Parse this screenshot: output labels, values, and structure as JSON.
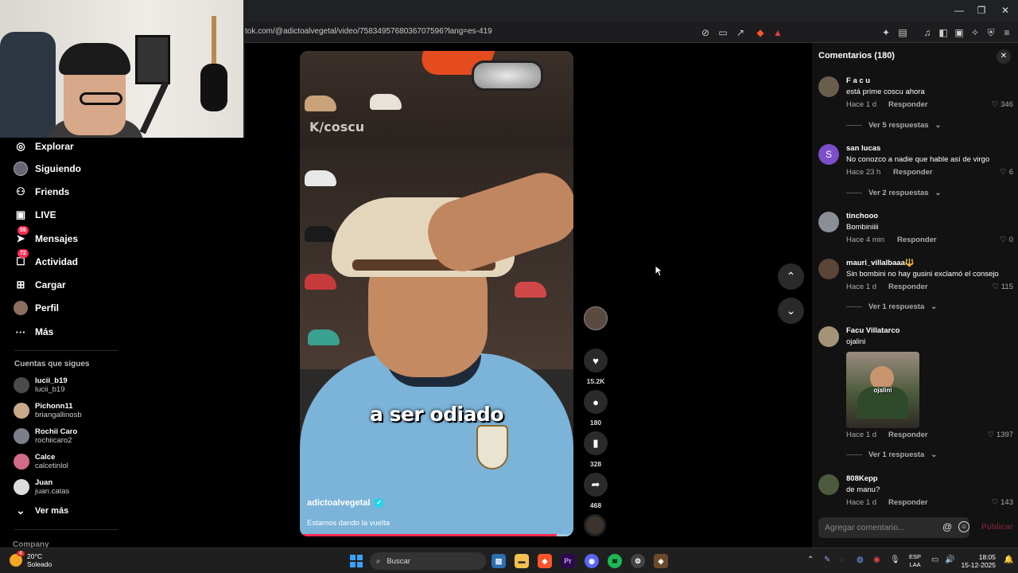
{
  "browser": {
    "url": "tok.com/@adictoalvegetal/video/7583495768036707596?lang=es-419",
    "window_controls": [
      "—",
      "❐",
      "✕"
    ]
  },
  "sidebar": {
    "items": [
      {
        "label": "Explorar",
        "icon": "compass-icon",
        "glyph": "◎",
        "badge": ""
      },
      {
        "label": "Siguiendo",
        "icon": "following-avatar-icon",
        "glyph": "●",
        "badge": ""
      },
      {
        "label": "Friends",
        "icon": "friends-icon",
        "glyph": "👥",
        "badge": ""
      },
      {
        "label": "LIVE",
        "icon": "live-icon",
        "glyph": "▣",
        "badge": ""
      },
      {
        "label": "Mensajes",
        "icon": "messages-icon",
        "glyph": "➤",
        "badge": "55"
      },
      {
        "label": "Actividad",
        "icon": "activity-icon",
        "glyph": "☐",
        "badge": "72"
      },
      {
        "label": "Cargar",
        "icon": "upload-icon",
        "glyph": "⊞",
        "badge": ""
      },
      {
        "label": "Perfil",
        "icon": "profile-icon",
        "glyph": "●",
        "badge": ""
      },
      {
        "label": "Más",
        "icon": "more-icon",
        "glyph": "···",
        "badge": ""
      }
    ],
    "following_title": "Cuentas que sigues",
    "accounts": [
      {
        "name": "lucii_b19",
        "user": "lucii_b19"
      },
      {
        "name": "Pichonn11",
        "user": "briangallinosb"
      },
      {
        "name": "Rochii Caro",
        "user": "rochiicaro2"
      },
      {
        "name": "Calce",
        "user": "calcetinlol"
      },
      {
        "name": "Juan",
        "user": "juan.catas"
      }
    ],
    "see_more": "Ver más",
    "company": "Company"
  },
  "video": {
    "watermark": "K/coscu",
    "caption": "a ser odiado",
    "author": "adictoalvegetal",
    "description": "Estamos dando la vuelta",
    "progress": 0.94
  },
  "actions": {
    "likes": "15.2K",
    "comments": "180",
    "saves": "328",
    "shares": "468"
  },
  "comments_panel": {
    "title": "Comentarios (180)",
    "close": "✕",
    "reply_label": "Responder",
    "comments": [
      {
        "name": "F a c u",
        "text": "está prime coscu ahora",
        "time": "Hace 1 d",
        "likes": "346",
        "more": "Ver 5 respuestas",
        "avatar_letter": ""
      },
      {
        "name": "san lucas",
        "text": "No conozco a nadie que hable así de virgo",
        "time": "Hace 23 h",
        "likes": "6",
        "more": "Ver 2 respuestas",
        "avatar_letter": "S"
      },
      {
        "name": "tinchooo",
        "text": "Bombiniiii",
        "time": "Hace 4 min",
        "likes": "0",
        "more": "",
        "avatar_letter": ""
      },
      {
        "name": "mauri_villalbaaa🔱",
        "text": "Sin bombini no hay gusini exclamó el consejo",
        "time": "Hace 1 d",
        "likes": "115",
        "more": "Ver 1 respuesta",
        "avatar_letter": ""
      },
      {
        "name": "Facu Villatarco",
        "text": "ojalini",
        "time": "Hace 1 d",
        "likes": "1397",
        "more": "Ver 1 respuesta",
        "avatar_letter": "",
        "gif_label": "ojalini"
      },
      {
        "name": "808Kepp",
        "text": "de manu?",
        "time": "Hace 1 d",
        "likes": "143",
        "more": "",
        "avatar_letter": ""
      }
    ],
    "input_placeholder": "Agregar comentario...",
    "post_label": "Publicar"
  },
  "taskbar": {
    "weather_temp": "20°C",
    "weather_desc": "Soleado",
    "weather_badge": "4",
    "search_placeholder": "Buscar",
    "lang_top": "ESP",
    "lang_bottom": "LAA",
    "time": "18:05",
    "date": "15-12-2025"
  },
  "colors": {
    "accent": "#fe2c55",
    "panel_bg": "#121212",
    "verified": "#20d5ec"
  }
}
